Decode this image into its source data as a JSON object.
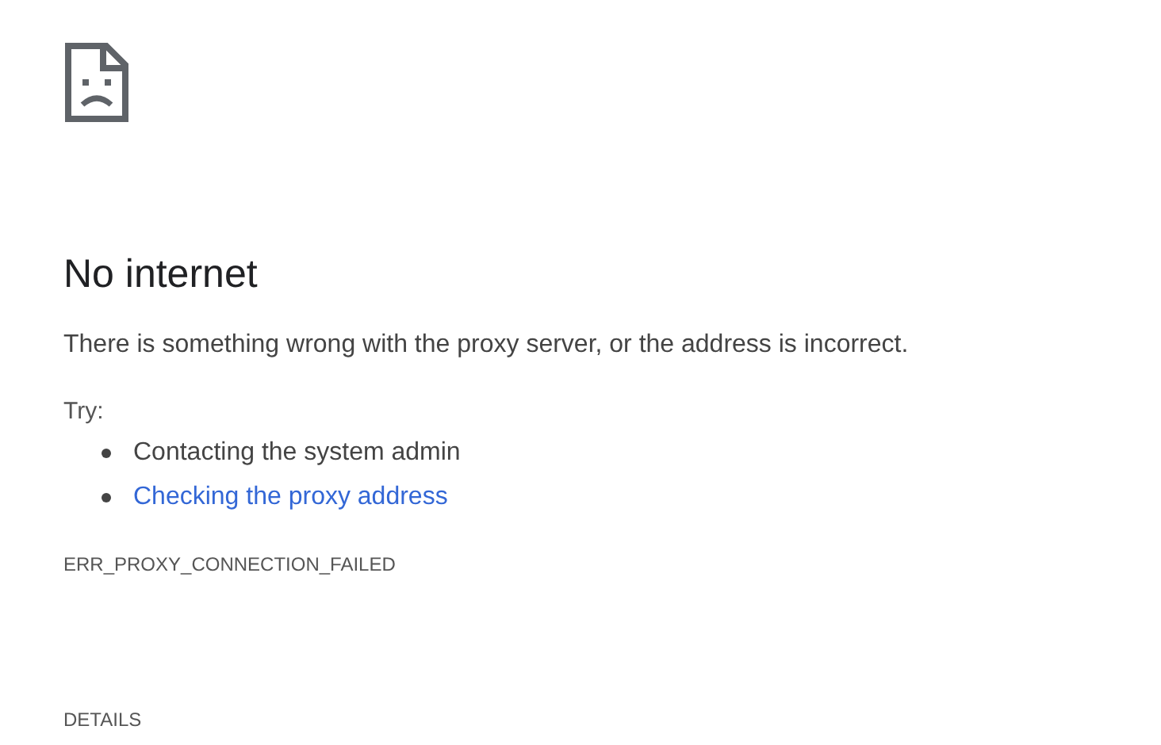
{
  "title": "No internet",
  "message": "There is something wrong with the proxy server, or the address is incorrect.",
  "suggestions_heading": "Try:",
  "suggestions": [
    {
      "kind": "text",
      "label": "Contacting the system admin"
    },
    {
      "kind": "link",
      "label": "Checking the proxy address"
    }
  ],
  "error_code": "ERR_PROXY_CONNECTION_FAILED",
  "details_button": "DETAILS"
}
